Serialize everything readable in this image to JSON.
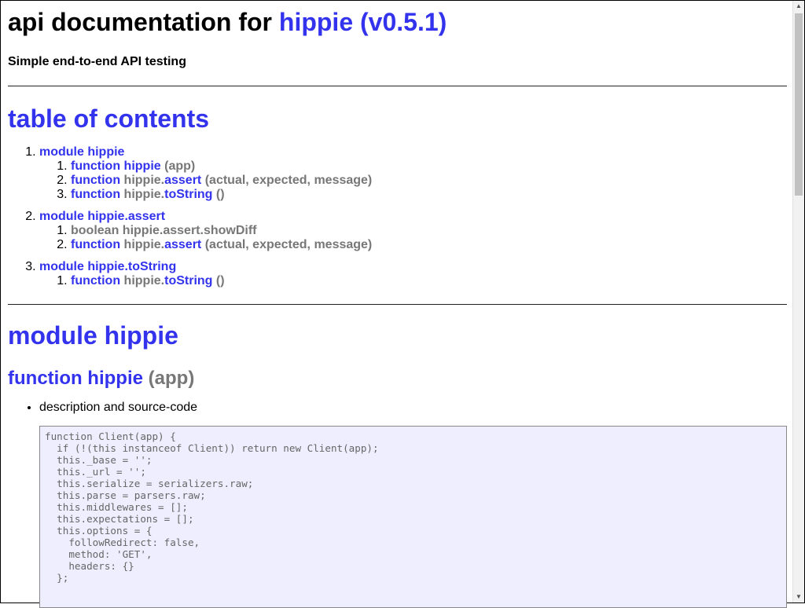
{
  "header": {
    "title_prefix": "api documentation for ",
    "title_link": "hippie (v0.5.1)",
    "subtitle": "Simple end-to-end API testing"
  },
  "toc": {
    "title": "table of contents",
    "modules": [
      {
        "label": "module hippie",
        "items": [
          {
            "kind": "function",
            "owner": "",
            "name": "hippie",
            "sig": "(app)"
          },
          {
            "kind": "function",
            "owner": "hippie.",
            "name": "assert",
            "sig": "(actual, expected, message)"
          },
          {
            "kind": "function",
            "owner": "hippie.",
            "name": "toString",
            "sig": "()"
          }
        ]
      },
      {
        "label": "module hippie.assert",
        "items": [
          {
            "kind": "boolean",
            "owner": "hippie.assert.showDiff",
            "name": "",
            "sig": ""
          },
          {
            "kind": "function",
            "owner": "hippie.",
            "name": "assert",
            "sig": "(actual, expected, message)"
          }
        ]
      },
      {
        "label": "module hippie.toString",
        "items": [
          {
            "kind": "function",
            "owner": "hippie.",
            "name": "toString",
            "sig": "()"
          }
        ]
      }
    ]
  },
  "section": {
    "module_title": "module hippie",
    "function_title": "function hippie",
    "function_sig": "(app)",
    "desc_label": "description and source-code",
    "code": "function Client(app) {\n  if (!(this instanceof Client)) return new Client(app);\n  this._base = '';\n  this._url = '';\n  this.serialize = serializers.raw;\n  this.parse = parsers.raw;\n  this.middlewares = [];\n  this.expectations = [];\n  this.options = {\n    followRedirect: false,\n    method: 'GET',\n    headers: {}\n  };"
  },
  "colors": {
    "link": "#3333ee",
    "muted": "#777777",
    "code_bg": "#eeeeff"
  }
}
